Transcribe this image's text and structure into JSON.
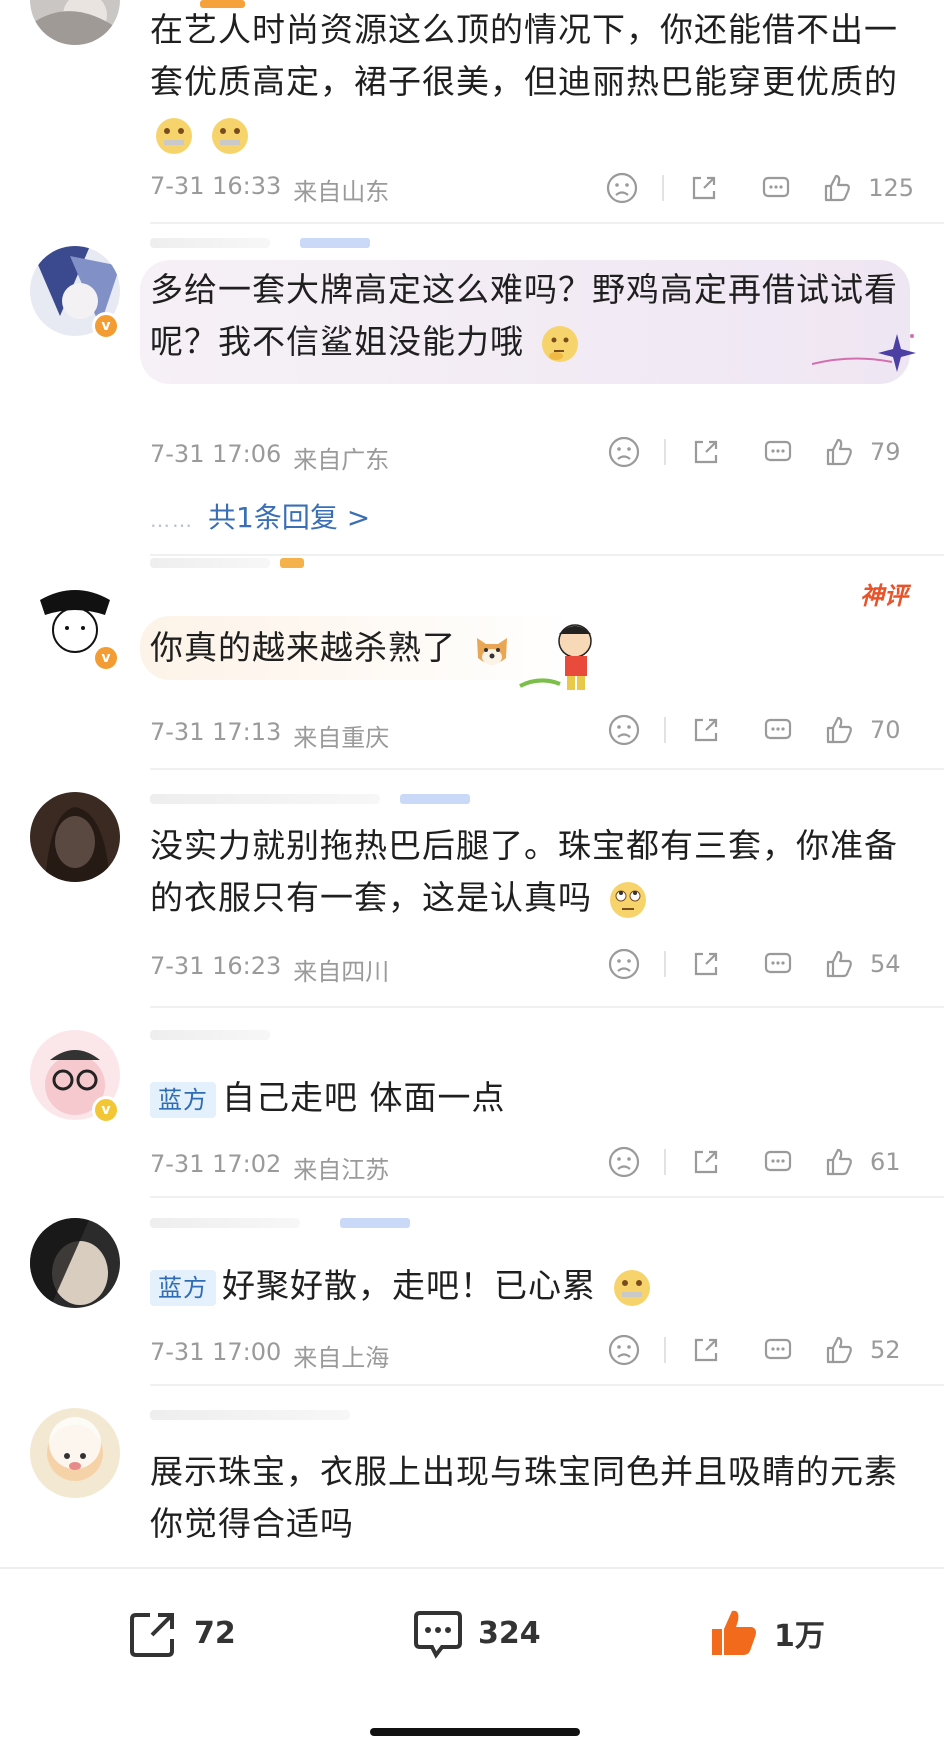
{
  "comments": [
    {
      "text": "在艺人时尚资源这么顶的情况下，你还能借不出一套优质高定，裙子很美，但迪丽热巴能穿更优质的",
      "time": "7-31 16:33",
      "location": "来自山东",
      "likes": "125",
      "emoji": "zipper-mouth"
    },
    {
      "text": "多给一套大牌高定这么难吗？野鸡高定再借试试看呢？我不信鲨姐没能力哦",
      "time": "7-31 17:06",
      "location": "来自广东",
      "likes": "79",
      "emoji": "thinking",
      "reply": "共1条回复 >",
      "reply_dots": "……"
    },
    {
      "text": "你真的越来越杀熟了",
      "time": "7-31 17:13",
      "location": "来自重庆",
      "likes": "70",
      "badge": "神评",
      "emoji": "dog"
    },
    {
      "text": "没实力就别拖热巴后腿了。珠宝都有三套，你准备的衣服只有一套，这是认真吗",
      "time": "7-31 16:23",
      "location": "来自四川",
      "likes": "54",
      "emoji": "eye-roll"
    },
    {
      "tag": "蓝方",
      "text": "自己走吧 体面一点",
      "time": "7-31 17:02",
      "location": "来自江苏",
      "likes": "61"
    },
    {
      "tag": "蓝方",
      "text": "好聚好散，走吧！已心累",
      "time": "7-31 17:00",
      "location": "来自上海",
      "likes": "52",
      "emoji": "zipper-mouth"
    },
    {
      "text": "展示珠宝，衣服上出现与珠宝同色并且吸睛的元素你觉得合适吗"
    }
  ],
  "bottom_bar": {
    "share": "72",
    "comment": "324",
    "like": "1万"
  },
  "colors": {
    "link": "#3a6fb5",
    "like_active": "#f26b1d",
    "verified": "#f39c34",
    "muted": "#9a9a9a"
  }
}
